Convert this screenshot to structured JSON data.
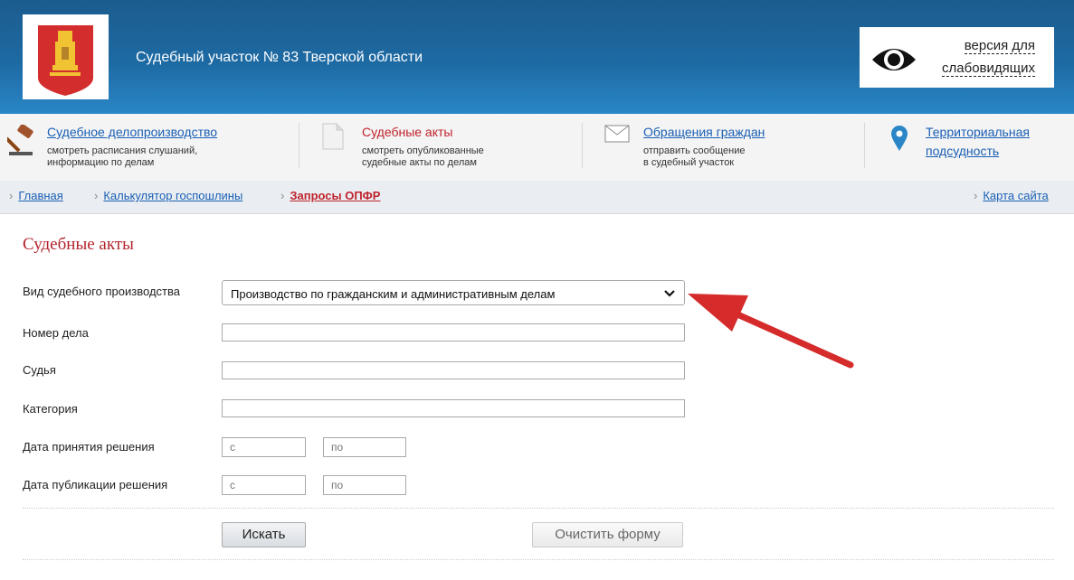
{
  "header": {
    "title": "Судебный участок № 83 Тверской области",
    "vision_line1": "версия для",
    "vision_line2": "слабовидящих"
  },
  "topnav": [
    {
      "title": "Судебное делопроизводство",
      "sub1": "смотреть расписания слушаний,",
      "sub2": "информацию по делам",
      "icon": "gavel-icon"
    },
    {
      "title": "Судебные акты",
      "sub1": "смотреть опубликованные",
      "sub2": "судебные акты по делам",
      "icon": "document-icon"
    },
    {
      "title": "Обращения граждан",
      "sub1": "отправить сообщение",
      "sub2": "в судебный участок",
      "icon": "envelope-icon"
    },
    {
      "title1": "Территориальная",
      "title2": "подсудность",
      "icon": "map-pin-icon"
    }
  ],
  "breadcrumb": {
    "home": "Главная",
    "calc": "Калькулятор госпошлины",
    "current": "Запросы ОПФР",
    "sitemap": "Карта сайта"
  },
  "page_title": "Судебные акты",
  "form": {
    "proc_label": "Вид судебного производства",
    "proc_value": "Производство по гражданским и административным делам",
    "case_label": "Номер дела",
    "judge_label": "Судья",
    "category_label": "Категория",
    "decision_label": "Дата принятия решения",
    "publish_label": "Дата публикации решения",
    "from_placeholder": "с",
    "to_placeholder": "по",
    "search_btn": "Искать",
    "clear_btn": "Очистить форму"
  },
  "colors": {
    "accent_red": "#c0232c",
    "link_blue": "#1a5fb4",
    "header_blue": "#1d6aa3"
  }
}
